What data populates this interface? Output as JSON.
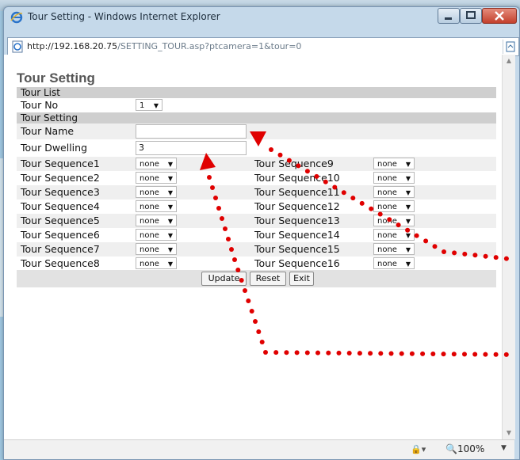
{
  "window": {
    "title": "Tour Setting - Windows Internet Explorer"
  },
  "address": {
    "host": "http://192.168.20.75",
    "path": "/SETTING_TOUR.asp?ptcamera=1&tour=0"
  },
  "page": {
    "title": "Tour Setting",
    "tour_list_header": "Tour List",
    "tour_no_label": "Tour No",
    "tour_no_value": "1",
    "tour_setting_header": "Tour Setting",
    "tour_name_label": "Tour Name",
    "tour_name_value": "",
    "tour_dwelling_label": "Tour Dwelling",
    "tour_dwelling_value": "3",
    "sequences_left": [
      {
        "label": "Tour Sequence1",
        "value": "none"
      },
      {
        "label": "Tour Sequence2",
        "value": "none"
      },
      {
        "label": "Tour Sequence3",
        "value": "none"
      },
      {
        "label": "Tour Sequence4",
        "value": "none"
      },
      {
        "label": "Tour Sequence5",
        "value": "none"
      },
      {
        "label": "Tour Sequence6",
        "value": "none"
      },
      {
        "label": "Tour Sequence7",
        "value": "none"
      },
      {
        "label": "Tour Sequence8",
        "value": "none"
      }
    ],
    "sequences_right": [
      {
        "label": "Tour Sequence9",
        "value": "none"
      },
      {
        "label": "Tour Sequence10",
        "value": "none"
      },
      {
        "label": "Tour Sequence11",
        "value": "none"
      },
      {
        "label": "Tour Sequence12",
        "value": "none"
      },
      {
        "label": "Tour Sequence13",
        "value": "none"
      },
      {
        "label": "Tour Sequence14",
        "value": "none"
      },
      {
        "label": "Tour Sequence15",
        "value": "none"
      },
      {
        "label": "Tour Sequence16",
        "value": "none"
      }
    ],
    "buttons": {
      "update": "Update",
      "reset": "Reset",
      "exit": "Exit"
    }
  },
  "statusbar": {
    "zoom": "100%"
  },
  "colors": {
    "annotation_dots": "#e00000"
  }
}
